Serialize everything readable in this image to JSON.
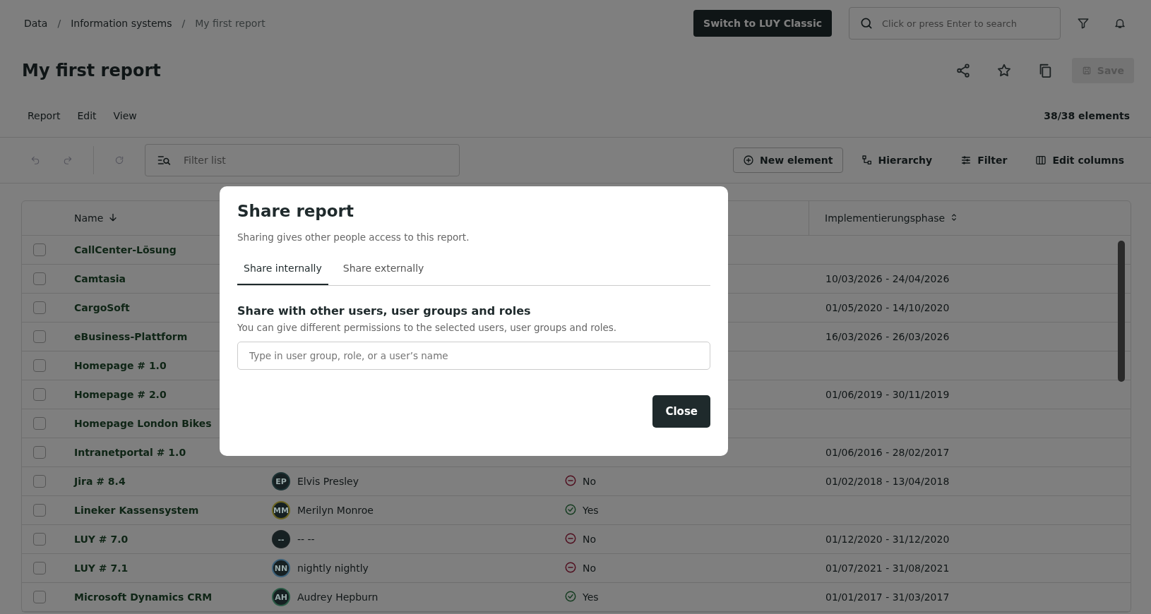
{
  "breadcrumb": [
    {
      "label": "Data",
      "current": false
    },
    {
      "label": "Information systems",
      "current": false
    },
    {
      "label": "My first report",
      "current": true
    }
  ],
  "separator": "/",
  "classic_button": "Switch to LUY Classic",
  "search": {
    "placeholder": "Click or press Enter to search"
  },
  "title": "My first report",
  "save_button": {
    "label": "Save",
    "disabled": true
  },
  "menu": [
    "Report",
    "Edit",
    "View"
  ],
  "element_count": "38/38 elements",
  "filter": {
    "placeholder": "Filter list"
  },
  "actions": [
    {
      "label": "New element",
      "kind": "new"
    },
    {
      "label": "Hierarchy",
      "kind": "hierarchy"
    },
    {
      "label": "Filter",
      "kind": "filter"
    },
    {
      "label": "Edit columns",
      "kind": "columns"
    }
  ],
  "table": {
    "columns": [
      {
        "label": "Name",
        "sorted": true
      },
      {
        "label": "Implementierungsphase",
        "sorted": false
      }
    ],
    "rows": [
      {
        "name": "CallCenter-Lösung",
        "checked": false
      },
      {
        "name": "Camtasia",
        "checked": false,
        "phase": "10/03/2026 - 24/04/2026"
      },
      {
        "name": "CargoSoft",
        "checked": false,
        "phase": "01/05/2020 - 14/10/2020"
      },
      {
        "name": "eBusiness-Plattform",
        "checked": false,
        "phase": "16/03/2026 - 26/03/2026"
      },
      {
        "name": "Homepage # 1.0",
        "checked": false
      },
      {
        "name": "Homepage # 2.0",
        "checked": false,
        "phase": "01/06/2019 - 30/11/2019"
      },
      {
        "name": "Homepage London Bikes",
        "checked": false
      },
      {
        "name": "Intranetportal # 1.0",
        "checked": false,
        "phase": "01/06/2016 - 28/02/2017"
      },
      {
        "name": "Jira # 8.4",
        "checked": false,
        "owner": {
          "initials": "EP",
          "name": "Elvis Presley",
          "color": "#1c3234"
        },
        "status": {
          "text": "No",
          "positive": false
        },
        "phase": "01/02/2018 - 13/04/2018"
      },
      {
        "name": "Lineker Kassensystem",
        "checked": false,
        "owner": {
          "initials": "MM",
          "name": "Merilyn Monroe",
          "color": "#6b6420"
        },
        "status": {
          "text": "Yes",
          "positive": true
        }
      },
      {
        "name": "LUY # 7.0",
        "checked": false,
        "owner": {
          "initials": "--",
          "name": "-- --",
          "color": "#1a2224"
        },
        "status": {
          "text": "No",
          "positive": false
        },
        "phase": "01/12/2020 - 31/12/2020"
      },
      {
        "name": "LUY # 7.1",
        "checked": false,
        "owner": {
          "initials": "NN",
          "name": "nightly nightly",
          "color": "#3a5f78"
        },
        "status": {
          "text": "No",
          "positive": false
        },
        "phase": "01/07/2021 - 31/08/2021"
      },
      {
        "name": "Microsoft Dynamics CRM",
        "checked": false,
        "owner": {
          "initials": "AH",
          "name": "Audrey Hepburn",
          "color": "#2a5a45"
        },
        "status": {
          "text": "Yes",
          "positive": true
        },
        "phase": "01/01/2017 - 31/03/2017"
      }
    ]
  },
  "dialog": {
    "title": "Share report",
    "subtitle": "Sharing gives other people access to this report.",
    "tabs": [
      {
        "label": "Share internally",
        "selected": true
      },
      {
        "label": "Share externally",
        "selected": false
      }
    ],
    "section_title": "Share with other users, user groups and roles",
    "section_text": "You can give different permissions to the selected users, user groups and roles.",
    "input": {
      "placeholder": "Type in user group, role, or a user’s name"
    },
    "close_button": "Close"
  }
}
